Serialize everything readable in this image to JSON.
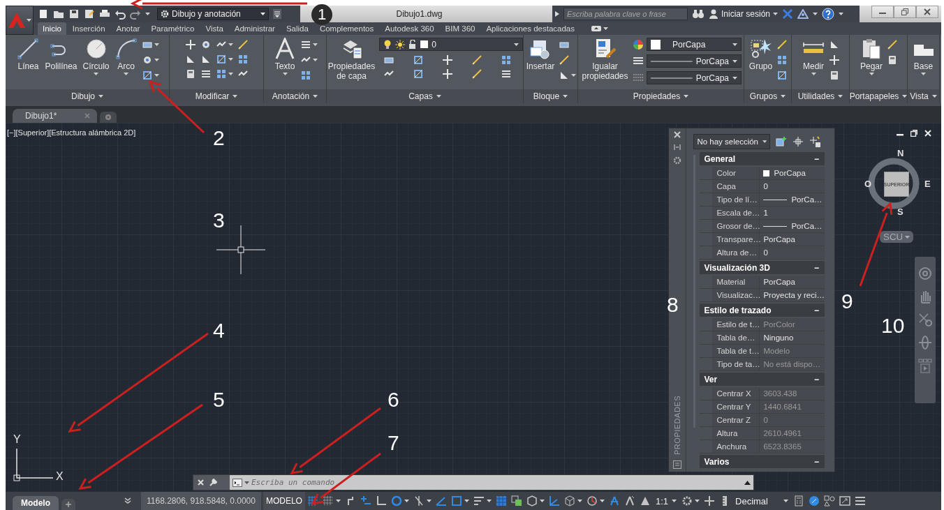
{
  "title_bar": {
    "workspace": "Dibujo y anotación",
    "title": "Dibujo1.dwg",
    "search": {
      "placeholder": "Escriba palabra clave o frase"
    },
    "sign_in": "Iniciar sesión"
  },
  "ribbon_tabs": [
    {
      "label": "Inicio",
      "selected": true
    },
    {
      "label": "Inserción",
      "selected": false
    },
    {
      "label": "Anotar",
      "selected": false
    },
    {
      "label": "Paramétrico",
      "selected": false
    },
    {
      "label": "Vista",
      "selected": false
    },
    {
      "label": "Administrar",
      "selected": false
    },
    {
      "label": "Salida",
      "selected": false
    },
    {
      "label": "Complementos",
      "selected": false
    },
    {
      "label": "Autodesk 360",
      "selected": false
    },
    {
      "label": "BIM 360",
      "selected": false
    },
    {
      "label": "Aplicaciones destacadas",
      "selected": false
    }
  ],
  "ribbon_panels": [
    {
      "title": "Dibujo",
      "kind": "draw",
      "tools": [
        "Línea",
        "Polilínea",
        "Círculo",
        "Arco"
      ]
    },
    {
      "title": "Modificar",
      "kind": "modify"
    },
    {
      "title": "Anotación",
      "kind": "annotate",
      "tools": [
        "Texto"
      ]
    },
    {
      "title": "Capas",
      "kind": "layers",
      "tools": [
        "Propiedades de capa"
      ],
      "layer": "0"
    },
    {
      "title": "Bloque",
      "kind": "block",
      "tools": [
        "Insertar"
      ]
    },
    {
      "title": "Propiedades",
      "kind": "properties",
      "tools": [
        "Igualar propiedades"
      ],
      "dropdowns": [
        "PorCapa",
        "PorCapa",
        "PorCapa"
      ]
    },
    {
      "title": "Grupos",
      "kind": "groups",
      "tools": [
        "Grupo"
      ]
    },
    {
      "title": "Utilidades",
      "kind": "utilities",
      "tools": [
        "Medir"
      ]
    },
    {
      "title": "Portapapeles",
      "kind": "clipboard",
      "tools": [
        "Pegar"
      ]
    },
    {
      "title": "Vista",
      "kind": "view",
      "tools": [
        "Base"
      ]
    }
  ],
  "document_tabs": [
    {
      "label": "Dibujo1*",
      "selected": true
    }
  ],
  "viewport_label": "[−][Superior][Estructura alámbrica 2D]",
  "ucs_icon": {
    "x": "X",
    "y": "Y"
  },
  "viewcube": {
    "north": "N",
    "south": "S",
    "east": "E",
    "west": "O",
    "face": "SUPERIOR",
    "ucs": "SCU"
  },
  "properties_palette": {
    "title": "PROPIEDADES",
    "selection": "No hay selección",
    "sections": [
      {
        "title": "General",
        "toggle": "−",
        "rows": [
          {
            "name": "Color",
            "value": "PorCapa",
            "kind": "color",
            "dimmed": false
          },
          {
            "name": "Capa",
            "value": "0",
            "kind": "text",
            "dimmed": false
          },
          {
            "name": "Tipo de lí…",
            "value": "PorCa…",
            "kind": "line",
            "dimmed": false
          },
          {
            "name": "Escala de…",
            "value": "1",
            "kind": "text",
            "dimmed": false
          },
          {
            "name": "Grosor de…",
            "value": "PorCa…",
            "kind": "line",
            "dimmed": false
          },
          {
            "name": "Transpare…",
            "value": "PorCapa",
            "kind": "text",
            "dimmed": false
          },
          {
            "name": "Altura de…",
            "value": "0",
            "kind": "text",
            "dimmed": false
          }
        ]
      },
      {
        "title": "Visualización 3D",
        "toggle": "−",
        "rows": [
          {
            "name": "Material",
            "value": "PorCapa",
            "kind": "text",
            "dimmed": false
          },
          {
            "name": "Visualizac…",
            "value": "Proyecta y reci…",
            "kind": "text",
            "dimmed": false
          }
        ]
      },
      {
        "title": "Estilo de trazado",
        "toggle": "−",
        "rows": [
          {
            "name": "Estilo de t…",
            "value": "PorColor",
            "kind": "text",
            "dimmed": true
          },
          {
            "name": "Tabla de…",
            "value": "Ninguno",
            "kind": "text",
            "dimmed": false
          },
          {
            "name": "Tabla de t…",
            "value": "Modelo",
            "kind": "text",
            "dimmed": true
          },
          {
            "name": "Tipo de ta…",
            "value": "No está dispo…",
            "kind": "text",
            "dimmed": true
          }
        ]
      },
      {
        "title": "Ver",
        "toggle": "−",
        "rows": [
          {
            "name": "Centrar X",
            "value": "3603.438",
            "kind": "text",
            "dimmed": true
          },
          {
            "name": "Centrar Y",
            "value": "1440.6841",
            "kind": "text",
            "dimmed": true
          },
          {
            "name": "Centrar Z",
            "value": "0",
            "kind": "text",
            "dimmed": true
          },
          {
            "name": "Altura",
            "value": "2610.4961",
            "kind": "text",
            "dimmed": true
          },
          {
            "name": "Anchura",
            "value": "6523.8365",
            "kind": "text",
            "dimmed": true
          }
        ]
      },
      {
        "title": "Varios",
        "toggle": "−"
      }
    ]
  },
  "command_line": {
    "placeholder": "Escriba un comando"
  },
  "layout_tabs": [
    {
      "label": "Modelo",
      "selected": true
    }
  ],
  "status_bar": {
    "coordinates": "1168.2806, 918.5848, 0.0000",
    "space": "MODELO",
    "scale": "1:1",
    "units": "Decimal",
    "toggles": [
      {
        "on": true
      },
      {
        "on": false
      },
      {
        "on": false
      },
      {
        "on": true
      },
      {
        "on": false
      },
      {
        "on": true
      },
      {
        "on": false
      },
      {
        "on": true
      },
      {
        "on": true
      },
      {
        "on": false
      },
      {
        "on": true
      },
      {
        "on": false
      },
      {
        "on": false
      },
      {
        "on": true
      },
      {
        "on": false
      },
      {
        "on": false
      },
      {
        "on": true
      },
      {
        "on": false
      },
      {
        "on": false
      },
      {
        "on": false
      },
      {
        "on": false
      },
      {
        "on": false
      },
      {
        "on": false
      },
      {
        "on": true
      },
      {
        "on": false
      },
      {
        "on": false
      },
      {
        "on": false
      }
    ]
  },
  "annotations": [
    {
      "label": "1"
    },
    {
      "label": "2"
    },
    {
      "label": "3"
    },
    {
      "label": "4"
    },
    {
      "label": "5"
    },
    {
      "label": "6"
    },
    {
      "label": "7"
    },
    {
      "label": "8"
    },
    {
      "label": "9"
    },
    {
      "label": "10"
    }
  ]
}
